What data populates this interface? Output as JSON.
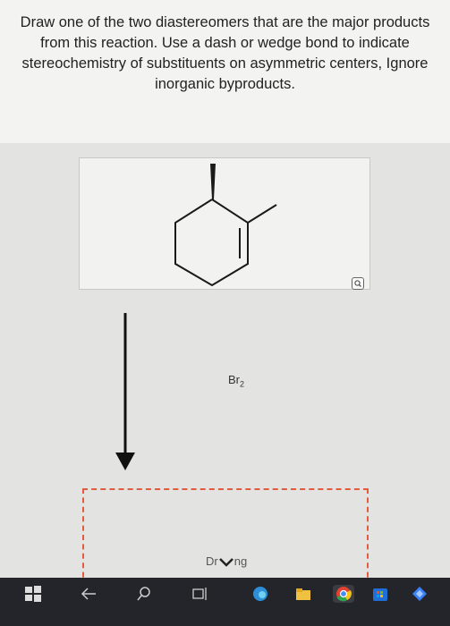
{
  "question": {
    "text": "Draw one of the two diastereomers that are the major products from this reaction. Use a dash or wedge bond to indicate stereochemistry of substituents on asymmetric centers, Ignore inorganic byproducts."
  },
  "reaction": {
    "reagent_prefix": "Br",
    "reagent_subscript": "2"
  },
  "answer_area": {
    "label_left": "Dr",
    "label_right": "ng"
  },
  "taskbar": {
    "icons": [
      "windows-start-icon",
      "back-arrow-icon",
      "search-icon",
      "task-view-icon",
      "edge-browser-icon",
      "file-explorer-icon",
      "chrome-icon",
      "store-icon",
      "app-icon"
    ]
  },
  "colors": {
    "dashed_border": "#e35b3e",
    "taskbar": "#23252a"
  }
}
